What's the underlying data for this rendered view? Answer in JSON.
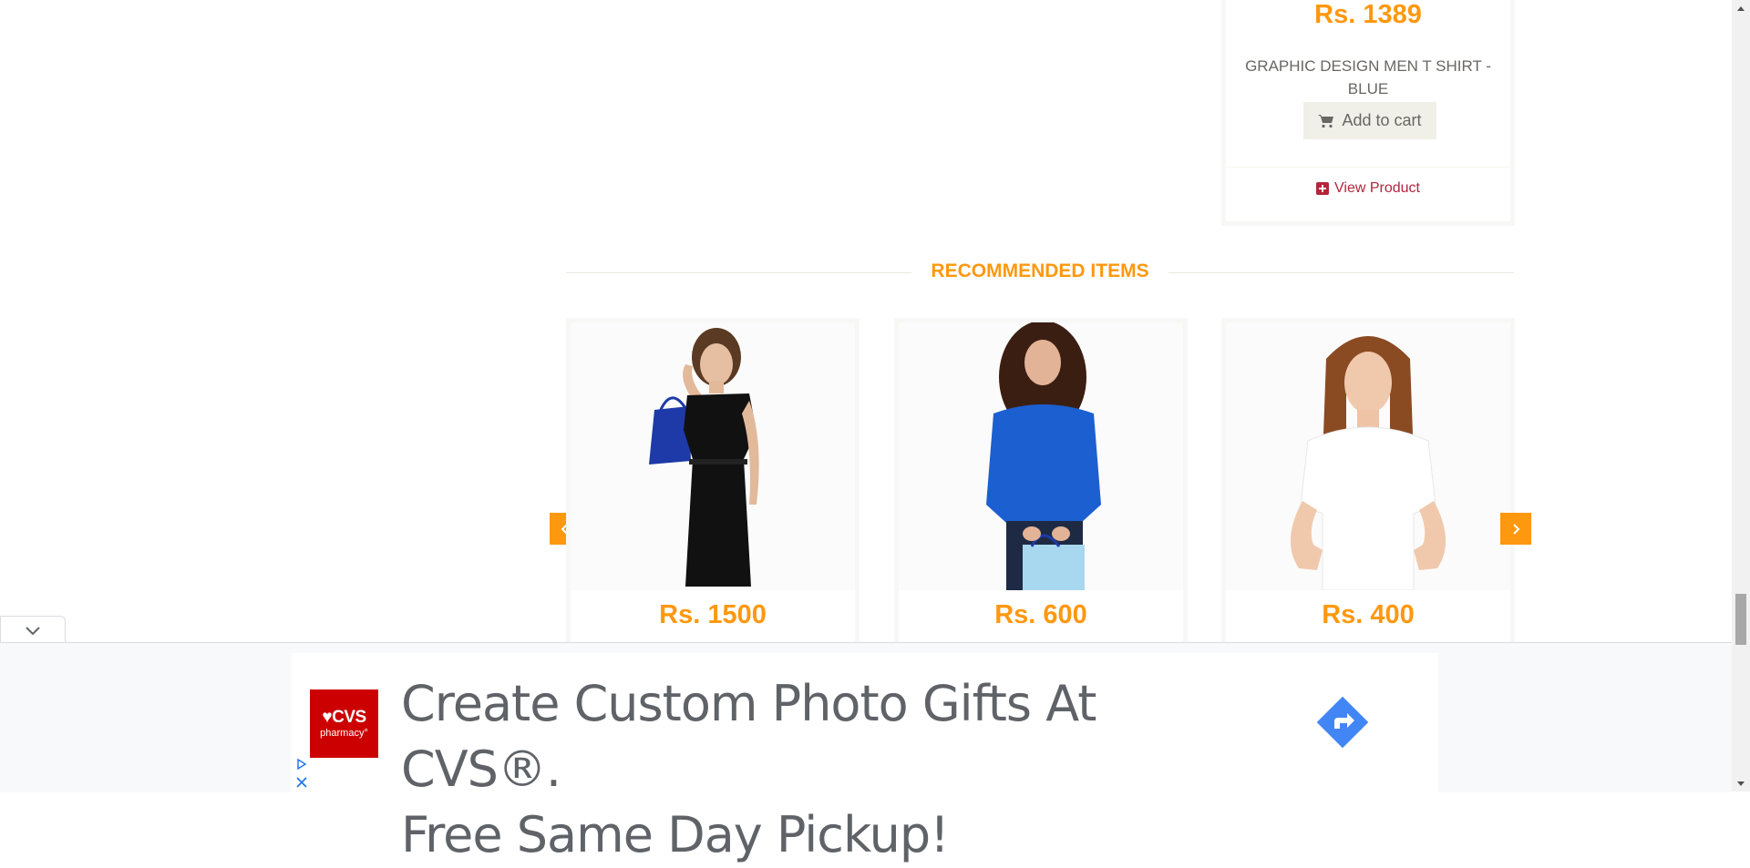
{
  "top_product": {
    "price": "Rs. 1389",
    "name": "GRAPHIC DESIGN MEN T SHIRT - BLUE",
    "add_to_cart": "Add to cart",
    "view_product": "View Product"
  },
  "recommended": {
    "title": "RECOMMENDED ITEMS",
    "items": [
      {
        "price": "Rs. 1500"
      },
      {
        "price": "Rs. 600"
      },
      {
        "price": "Rs. 400"
      }
    ]
  },
  "ad": {
    "brand": "♥CVS",
    "brand_sub": "pharmacy°",
    "headline_line1": "Create Custom Photo Gifts At CVS®.",
    "headline_line2": "Free Same Day Pickup!"
  },
  "icons": {
    "cart": "cart-icon",
    "view": "plus-square-icon",
    "prev": "chevron-left-icon",
    "next": "chevron-right-icon",
    "collapse": "chevron-down-icon",
    "ad_go": "arrow-redirect-icon",
    "adchoices": "adchoices-icon",
    "close": "close-icon"
  },
  "colors": {
    "accent": "#FE980F",
    "link": "#B3253C",
    "ad_red": "#CC0000",
    "ad_blue": "#4285F4"
  }
}
